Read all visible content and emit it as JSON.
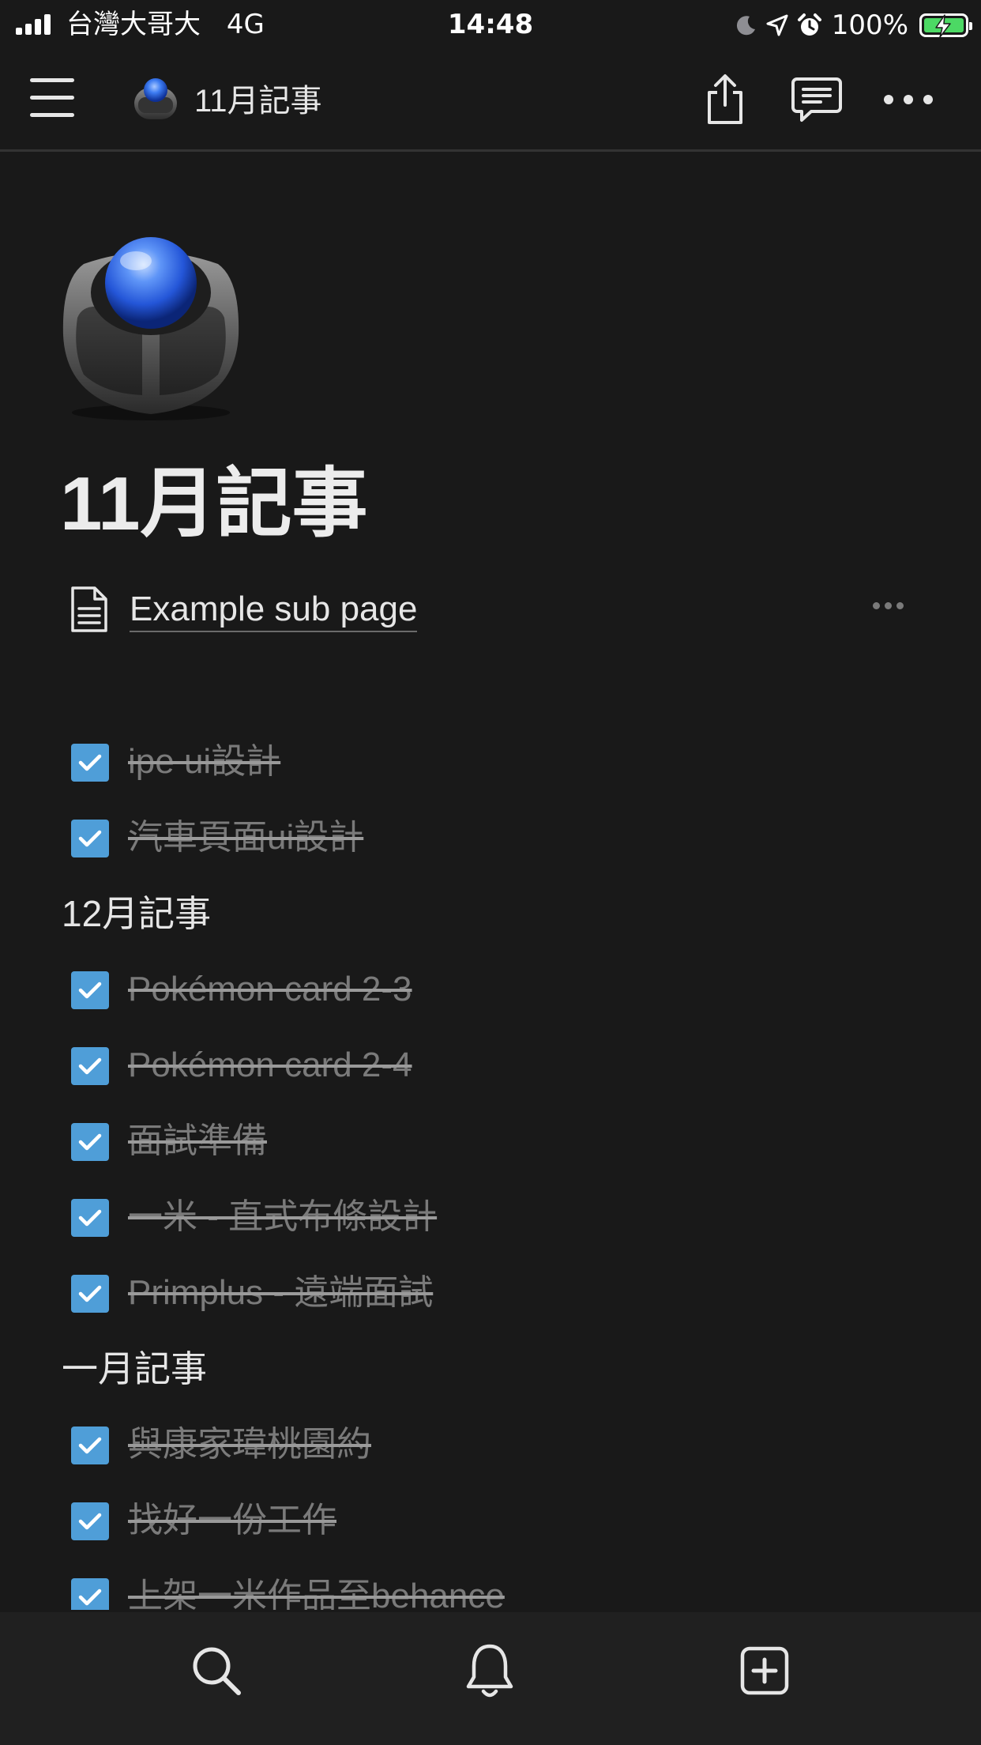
{
  "status_bar": {
    "carrier": "台灣大哥大",
    "network": "4G",
    "time": "14:48",
    "battery_percent": "100%",
    "battery_level": 1.0,
    "icons": [
      "signal-bars-icon",
      "moon-icon",
      "location-arrow-icon",
      "alarm-clock-icon",
      "battery-charging-icon"
    ],
    "battery_color": "#4cd964"
  },
  "nav": {
    "page_icon": "trackball-icon",
    "title": "11月記事",
    "actions": [
      "share-icon",
      "comment-icon",
      "more-icon"
    ]
  },
  "page": {
    "title": "11月記事",
    "subpage": {
      "icon": "document-icon",
      "label": "Example sub page"
    },
    "blocks": [
      {
        "type": "todo",
        "checked": true,
        "text": "ipe ui設計"
      },
      {
        "type": "todo",
        "checked": true,
        "text": "汽車頁面ui設計"
      },
      {
        "type": "heading",
        "text": "12月記事"
      },
      {
        "type": "todo",
        "checked": true,
        "text": "Pokémon card 2-3"
      },
      {
        "type": "todo",
        "checked": true,
        "text": "Pokémon card 2-4"
      },
      {
        "type": "todo",
        "checked": true,
        "text": "面試準備"
      },
      {
        "type": "todo",
        "checked": true,
        "text": "一米 - 直式布條設計"
      },
      {
        "type": "todo",
        "checked": true,
        "text": "Primplus - 遠端面試"
      },
      {
        "type": "heading",
        "text": "一月記事"
      },
      {
        "type": "todo",
        "checked": true,
        "text": "與康家瑋桃園約"
      },
      {
        "type": "todo",
        "checked": true,
        "text": "找好一份工作"
      },
      {
        "type": "todo",
        "checked": true,
        "text": "上架一米作品至behance"
      }
    ]
  },
  "tabbar": {
    "items": [
      "search-icon",
      "bell-icon",
      "add-page-icon"
    ]
  },
  "colors": {
    "background": "#191919",
    "checkbox": "#4f9ed8",
    "completed_text": "#7a7a7a",
    "tabbar": "#202020"
  }
}
